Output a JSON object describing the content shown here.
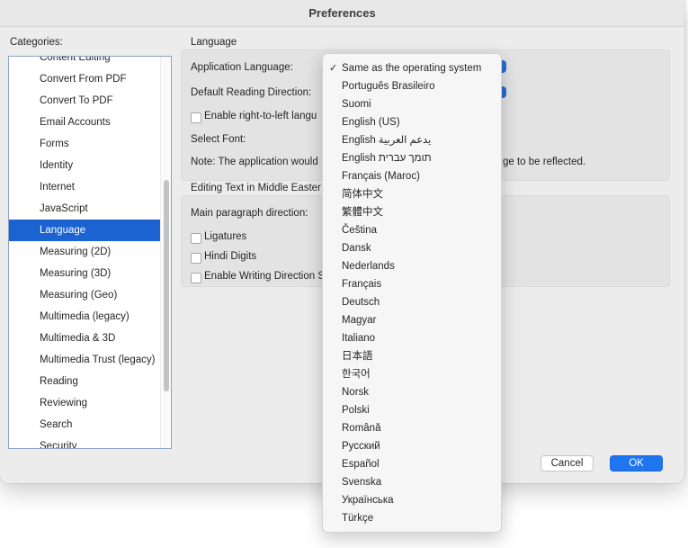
{
  "window": {
    "title": "Preferences"
  },
  "categories": {
    "label": "Categories:",
    "items": [
      "Content Editing",
      "Convert From PDF",
      "Convert To PDF",
      "Email Accounts",
      "Forms",
      "Identity",
      "Internet",
      "JavaScript",
      "Language",
      "Measuring (2D)",
      "Measuring (3D)",
      "Measuring (Geo)",
      "Multimedia (legacy)",
      "Multimedia & 3D",
      "Multimedia Trust (legacy)",
      "Reading",
      "Reviewing",
      "Search",
      "Security"
    ],
    "selected": "Language"
  },
  "language": {
    "section_title": "Language",
    "app_language_label": "Application Language:",
    "reading_direction_label": "Default Reading Direction:",
    "rtl_label": "Enable right-to-left langu",
    "select_font_label": "Select Font:",
    "note_start": "Note: The application would",
    "note_end": "ge to be reflected."
  },
  "middle_eastern": {
    "section_title": "Editing Text in Middle Easter",
    "main_para_label": "Main paragraph direction:",
    "ligatures_label": "Ligatures",
    "hindi_digits_label": "Hindi Digits",
    "writing_direction_label": "Enable Writing Direction S"
  },
  "buttons": {
    "cancel": "Cancel",
    "ok": "OK"
  },
  "language_menu": {
    "checkmark": "✓",
    "selected_index": 0,
    "items": [
      "Same as the operating system",
      "Português Brasileiro",
      "Suomi",
      "English (US)",
      "English يدعم العربية",
      "English תומך עברית",
      "Français (Maroc)",
      "简体中文",
      "繁體中文",
      "Čeština",
      "Dansk",
      "Nederlands",
      "Français",
      "Deutsch",
      "Magyar",
      "Italiano",
      "日本語",
      "한국어",
      "Norsk",
      "Polski",
      "Română",
      "Русский",
      "Español",
      "Svenska",
      "Українська",
      "Türkçe"
    ]
  },
  "colors": {
    "accent": "#1a63d1",
    "ok_button": "#1f74f0"
  }
}
